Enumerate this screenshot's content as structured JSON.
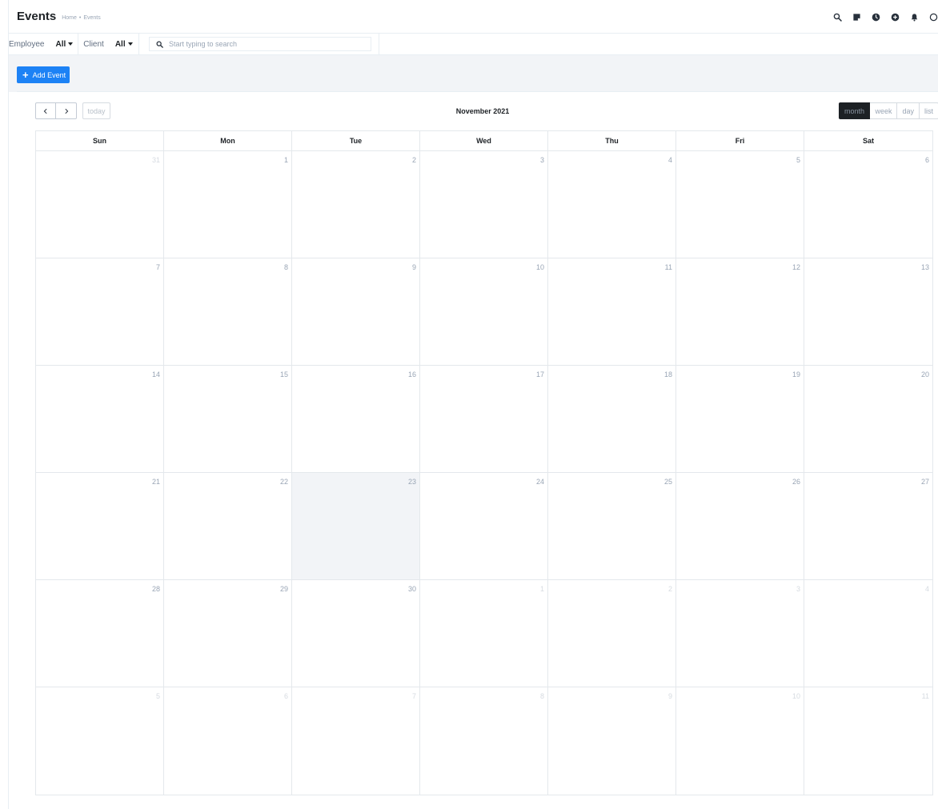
{
  "header": {
    "title": "Events",
    "breadcrumb": [
      "Home",
      "Events"
    ],
    "breadcrumb_sep": "•",
    "icons": [
      "search-icon",
      "sticky-note-icon",
      "clock-icon",
      "plus-circle-icon",
      "bell-icon"
    ]
  },
  "filters": {
    "employee_label": "Employee",
    "employee_value": "All",
    "client_label": "Client",
    "client_value": "All",
    "search_placeholder": "Start typing to search",
    "search_value": ""
  },
  "actions": {
    "add_event_label": "Add Event"
  },
  "calendar": {
    "title": "November 2021",
    "today_label": "today",
    "views": [
      "month",
      "week",
      "day",
      "list"
    ],
    "active_view": "month",
    "days_of_week": [
      "Sun",
      "Mon",
      "Tue",
      "Wed",
      "Thu",
      "Fri",
      "Sat"
    ],
    "today_date": "23",
    "weeks": [
      [
        {
          "n": "31",
          "other": true
        },
        {
          "n": "1"
        },
        {
          "n": "2"
        },
        {
          "n": "3"
        },
        {
          "n": "4"
        },
        {
          "n": "5"
        },
        {
          "n": "6"
        }
      ],
      [
        {
          "n": "7"
        },
        {
          "n": "8"
        },
        {
          "n": "9"
        },
        {
          "n": "10"
        },
        {
          "n": "11"
        },
        {
          "n": "12"
        },
        {
          "n": "13"
        }
      ],
      [
        {
          "n": "14"
        },
        {
          "n": "15"
        },
        {
          "n": "16"
        },
        {
          "n": "17"
        },
        {
          "n": "18"
        },
        {
          "n": "19"
        },
        {
          "n": "20"
        }
      ],
      [
        {
          "n": "21"
        },
        {
          "n": "22"
        },
        {
          "n": "23",
          "today": true
        },
        {
          "n": "24"
        },
        {
          "n": "25"
        },
        {
          "n": "26"
        },
        {
          "n": "27"
        }
      ],
      [
        {
          "n": "28"
        },
        {
          "n": "29"
        },
        {
          "n": "30"
        },
        {
          "n": "1",
          "other": true
        },
        {
          "n": "2",
          "other": true
        },
        {
          "n": "3",
          "other": true
        },
        {
          "n": "4",
          "other": true
        }
      ],
      [
        {
          "n": "5",
          "other": true
        },
        {
          "n": "6",
          "other": true
        },
        {
          "n": "7",
          "other": true
        },
        {
          "n": "8",
          "other": true
        },
        {
          "n": "9",
          "other": true
        },
        {
          "n": "10",
          "other": true
        },
        {
          "n": "11",
          "other": true
        }
      ]
    ]
  },
  "colors": {
    "accent": "#1d82f5",
    "dark": "#1d2125",
    "today_bg": "#f2f4f7"
  }
}
